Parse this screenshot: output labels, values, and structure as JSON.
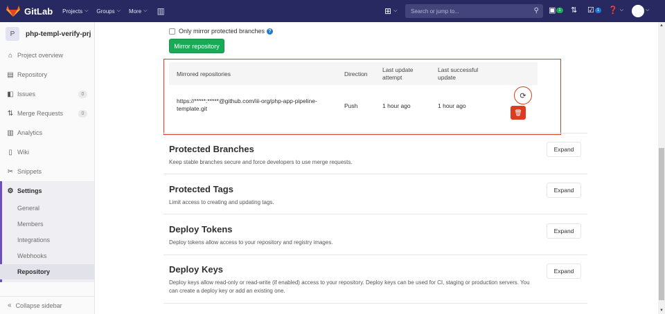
{
  "navbar": {
    "brand": "GitLab",
    "links": [
      "Projects",
      "Groups",
      "More"
    ],
    "search_placeholder": "Search or jump to...",
    "todo_count": "1",
    "issue_count": "1"
  },
  "sidebar": {
    "project_initial": "P",
    "project_name": "php-templ-verify-prj",
    "items": [
      {
        "label": "Project overview",
        "icon": "home-icon"
      },
      {
        "label": "Repository",
        "icon": "doc-icon"
      },
      {
        "label": "Issues",
        "icon": "issues-icon",
        "count": "0"
      },
      {
        "label": "Merge Requests",
        "icon": "merge-icon",
        "count": "0"
      },
      {
        "label": "Analytics",
        "icon": "chart-icon"
      },
      {
        "label": "Wiki",
        "icon": "book-icon"
      },
      {
        "label": "Snippets",
        "icon": "scissors-icon"
      },
      {
        "label": "Settings",
        "icon": "gear-icon"
      }
    ],
    "settings_items": [
      "General",
      "Members",
      "Integrations",
      "Webhooks",
      "Repository"
    ],
    "collapse_label": "Collapse sidebar"
  },
  "mirror": {
    "only_protected_label": "Only mirror protected branches",
    "button_label": "Mirror repository",
    "headers": {
      "repos": "Mirrored repositories",
      "direction": "Direction",
      "last_attempt": "Last update attempt",
      "last_success": "Last successful update"
    },
    "row": {
      "url_line1": "https://*****:*****@github.com/iii-org/php-app-pipeline-",
      "url_line2": "template.git",
      "direction": "Push",
      "last_attempt": "1 hour ago",
      "last_success": "1 hour ago"
    }
  },
  "sections": [
    {
      "title": "Protected Branches",
      "desc": "Keep stable branches secure and force developers to use merge requests.",
      "button": "Expand"
    },
    {
      "title": "Protected Tags",
      "desc": "Limit access to creating and updating tags.",
      "button": "Expand"
    },
    {
      "title": "Deploy Tokens",
      "desc": "Deploy tokens allow access to your repository and registry images.",
      "button": "Expand"
    },
    {
      "title": "Deploy Keys",
      "desc": "Deploy keys allow read-only or read-write (if enabled) access to your repository. Deploy keys can be used for CI, staging or production servers. You can create a deploy key or add an existing one.",
      "button": "Expand"
    }
  ]
}
